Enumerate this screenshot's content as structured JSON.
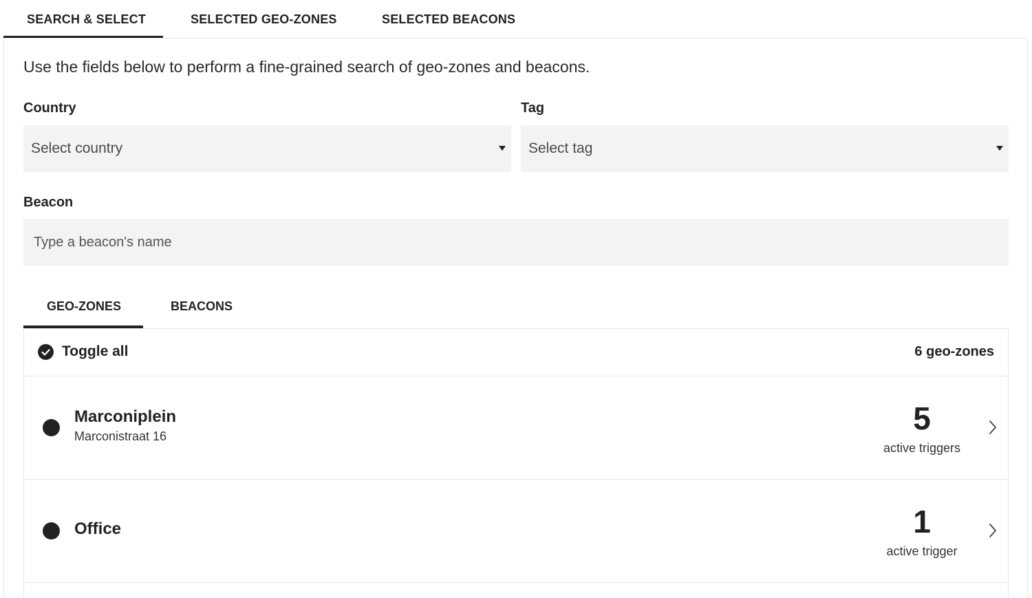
{
  "tabs": [
    {
      "label": "SEARCH & SELECT",
      "active": true
    },
    {
      "label": "SELECTED GEO-ZONES",
      "active": false
    },
    {
      "label": "SELECTED BEACONS",
      "active": false
    }
  ],
  "intro": "Use the fields below to perform a fine-grained search of geo-zones and beacons.",
  "fields": {
    "country": {
      "label": "Country",
      "placeholder": "Select country"
    },
    "tag": {
      "label": "Tag",
      "placeholder": "Select tag"
    },
    "beacon": {
      "label": "Beacon",
      "placeholder": "Type a beacon's name"
    }
  },
  "sub_tabs": [
    {
      "label": "GEO-ZONES",
      "active": true
    },
    {
      "label": "BEACONS",
      "active": false
    }
  ],
  "list": {
    "toggle_label": "Toggle all",
    "count_label": "6 geo-zones",
    "items": [
      {
        "name": "Marconiplein",
        "address": "Marconistraat 16",
        "triggers": "5",
        "trigger_label": "active triggers"
      },
      {
        "name": "Office",
        "address": "",
        "triggers": "1",
        "trigger_label": "active trigger"
      }
    ]
  },
  "colors": {
    "text": "#222222",
    "field_bg": "#f2f3f4",
    "border": "#e7e7e7",
    "accent": "#222222"
  },
  "icons": {
    "toggle": "check-circle-icon",
    "status": "status-dot-icon",
    "row_nav": "chevron-right-icon",
    "dropdown": "caret-down-icon"
  }
}
